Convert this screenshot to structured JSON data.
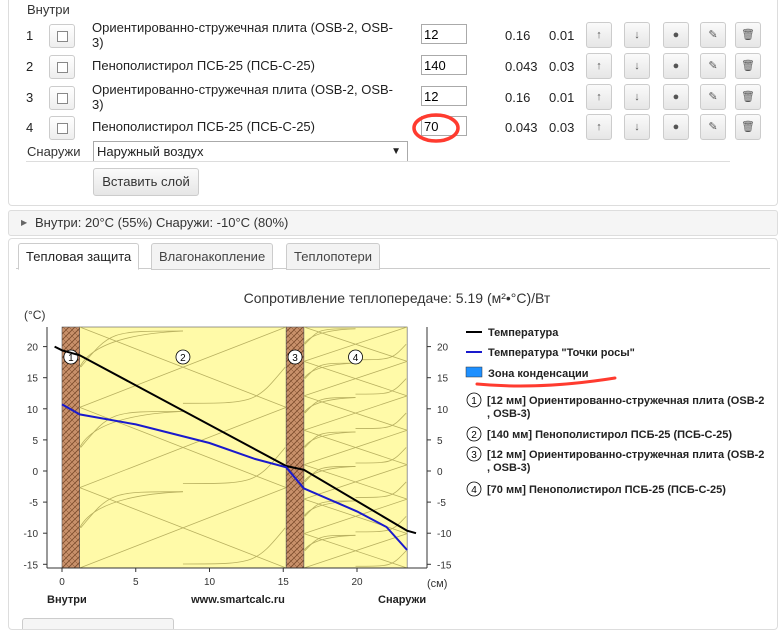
{
  "layers": {
    "inside_label": "Внутри",
    "outside_label": "Снаружи",
    "outside_select": "Наружный воздух",
    "add_button": "Вставить слой",
    "rows": [
      {
        "num": "1",
        "material": "Ориентированно-стружечная плита (OSB-2, OSB-3)",
        "thickness": "12",
        "lambda": "0.16",
        "mu": "0.01"
      },
      {
        "num": "2",
        "material": "Пенополистирол ПСБ-25 (ПСБ-С-25)",
        "thickness": "140",
        "lambda": "0.043",
        "mu": "0.03"
      },
      {
        "num": "3",
        "material": "Ориентированно-стружечная плита (OSB-2, OSB-3)",
        "thickness": "12",
        "lambda": "0.16",
        "mu": "0.01"
      },
      {
        "num": "4",
        "material": "Пенополистирол ПСБ-25 (ПСБ-С-25)",
        "thickness": "70",
        "lambda": "0.043",
        "mu": "0.03"
      }
    ],
    "row_icons": [
      "arrow-up-icon",
      "arrow-down-icon",
      "dot-icon",
      "pencil-icon",
      "trash-icon"
    ]
  },
  "conditions": {
    "summary": "Внутри: 20°C (55%) Снаружи: -10°C (80%)"
  },
  "tabs": [
    "Тепловая защита",
    "Влагонакопление",
    "Теплопотери"
  ],
  "active_tab": 0,
  "colors": {
    "temperature": "#000000",
    "dew_point": "#1a1acc",
    "condensation": "#1e90ff",
    "osb": "#c8906a",
    "eps": "#fffaa8",
    "highlight": "#ff3b2f"
  },
  "chart_data": {
    "type": "line",
    "title": "Сопротивление теплопередаче: 5.19 (м²•°С)/Вт",
    "ylabel": "(°C)",
    "xlabel": "(см)",
    "ylim": [
      -15,
      23
    ],
    "xlim": [
      -1,
      24.5
    ],
    "xticks": [
      0,
      5,
      10,
      15,
      20
    ],
    "yticks": [
      20,
      15,
      10,
      5,
      0,
      -5,
      -10,
      -15
    ],
    "bottom_left": "Внутри",
    "bottom_center": "www.smartcalc.ru",
    "bottom_right": "Снаружи",
    "layers": [
      {
        "label": "1",
        "start": 0,
        "end": 1.2,
        "kind": "osb"
      },
      {
        "label": "2",
        "start": 1.2,
        "end": 15.2,
        "kind": "eps"
      },
      {
        "label": "3",
        "start": 15.2,
        "end": 16.4,
        "kind": "osb"
      },
      {
        "label": "4",
        "start": 16.4,
        "end": 23.4,
        "kind": "eps"
      }
    ],
    "series": [
      {
        "name": "Температура",
        "x": [
          -0.5,
          0,
          1.2,
          15.2,
          16.4,
          23.4,
          24.0
        ],
        "y": [
          20.0,
          19.4,
          18.6,
          0.8,
          0.2,
          -9.6,
          -10.0
        ]
      },
      {
        "name": "Температура \"Точки росы\"",
        "x": [
          0,
          1.2,
          5,
          10,
          13,
          15.2,
          16.4,
          20,
          22,
          23.4
        ],
        "y": [
          10.7,
          9.1,
          7.5,
          4.5,
          2.0,
          0.6,
          -2.8,
          -6.5,
          -9.0,
          -12.7
        ]
      }
    ],
    "legend": {
      "temperature": "Температура",
      "dew_point": "Температура \"Точки росы\"",
      "condensation": "Зона конденсации",
      "layers": [
        {
          "num": "1",
          "text": "[12 мм] Ориентированно-стружечная плита (OSB-2, OSB-3)"
        },
        {
          "num": "2",
          "text": "[140 мм] Пенополистирол ПСБ-25 (ПСБ-С-25)"
        },
        {
          "num": "3",
          "text": "[12 мм] Ориентированно-стружечная плита (OSB-2, OSB-3)"
        },
        {
          "num": "4",
          "text": "[70 мм] Пенополистирол ПСБ-25 (ПСБ-С-25)"
        }
      ]
    }
  }
}
